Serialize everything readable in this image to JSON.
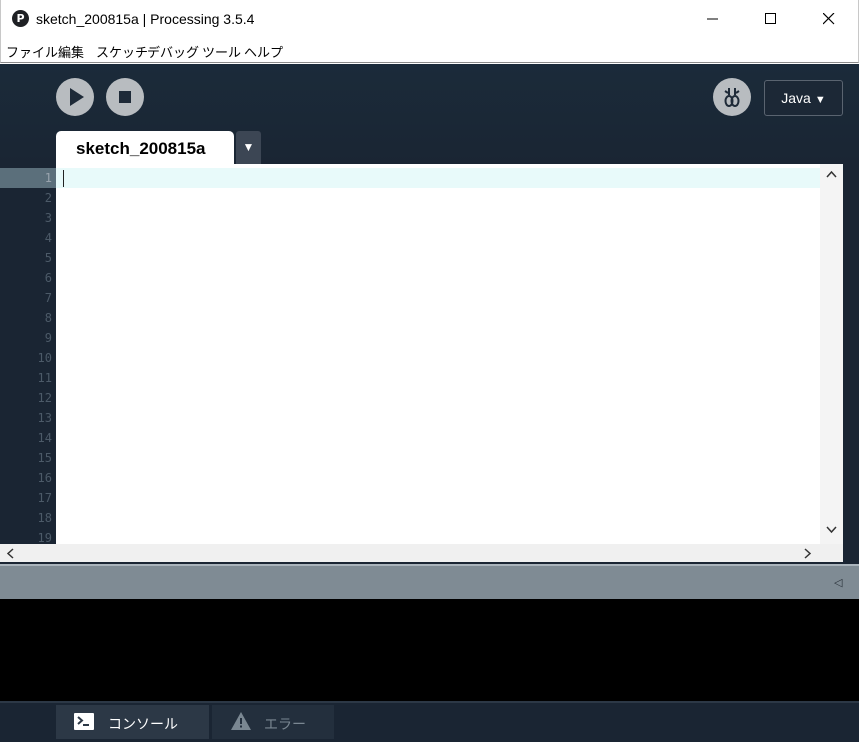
{
  "window": {
    "title": "sketch_200815a | Processing 3.5.4",
    "app_icon_glyph": "P",
    "icons": {
      "minimize": "minimize-icon",
      "maximize": "maximize-icon",
      "close": "close-icon"
    }
  },
  "menu": {
    "items": [
      "ファイル",
      "編集",
      "スケッチ",
      "デバッグ",
      "ツール",
      "ヘルプ"
    ]
  },
  "toolbar": {
    "run_icon": "play-icon",
    "stop_icon": "stop-icon",
    "debug_icon": "debugger-icon",
    "mode_label": "Java",
    "mode_arrow": "▼"
  },
  "tabs": {
    "active_label": "sketch_200815a",
    "menu_arrow": "▼"
  },
  "editor": {
    "current_line": 1,
    "line_numbers": [
      "1",
      "2",
      "3",
      "4",
      "5",
      "6",
      "7",
      "8",
      "9",
      "10",
      "11",
      "12",
      "13",
      "14",
      "15",
      "16",
      "17",
      "18",
      "19"
    ],
    "content": ""
  },
  "divider": {
    "collapse_glyph": "◁"
  },
  "footer": {
    "console_label": "コンソール",
    "error_label": "エラー",
    "console_icon": "console-icon",
    "error_icon": "warning-icon"
  },
  "colors": {
    "header_bg": "#1a2533",
    "button_bg": "#b8bcc0",
    "current_line_bg": "#e8fafa",
    "console_bg": "#000000"
  }
}
